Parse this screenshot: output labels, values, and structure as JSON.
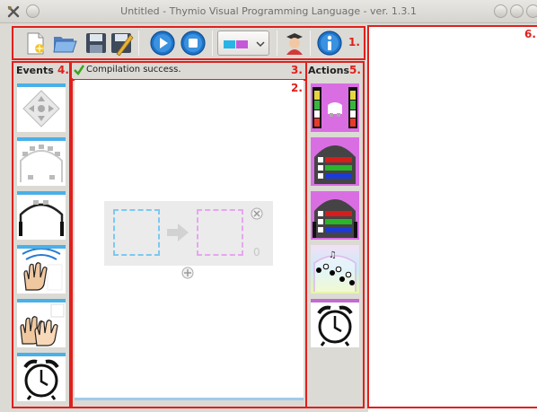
{
  "window": {
    "title": "Untitled - Thymio Visual Programming Language - ver. 1.3.1"
  },
  "toolbar": {
    "new_icon": "new-document-icon",
    "open_icon": "open-folder-icon",
    "save_icon": "save-icon",
    "save_as_icon": "save-as-icon",
    "run_icon": "run-icon",
    "stop_icon": "stop-icon",
    "color_scheme_icon": "color-scheme-icon",
    "advanced_mode_icon": "advanced-mode-icon",
    "help_icon": "help-icon"
  },
  "labels": {
    "toolbar": "1.",
    "scene": "2.",
    "status": "3.",
    "events": "4.",
    "actions": "5.",
    "code": "6."
  },
  "events": {
    "title": "Events",
    "items": [
      "buttons-event",
      "prox-event",
      "prox-ground-event",
      "tap-event",
      "clap-event",
      "timer-event"
    ]
  },
  "actions": {
    "title": "Actions",
    "items": [
      "move-action",
      "top-color-action",
      "bottom-color-action",
      "sound-action",
      "timer-action"
    ]
  },
  "status": {
    "message": "Compilation success.",
    "state": "ok"
  },
  "event_action_pair": {
    "counter": "0"
  },
  "colors": {
    "highlight": "#e0201c",
    "event_blue": "#4ab0e8",
    "action_purple": "#c26bd0"
  }
}
